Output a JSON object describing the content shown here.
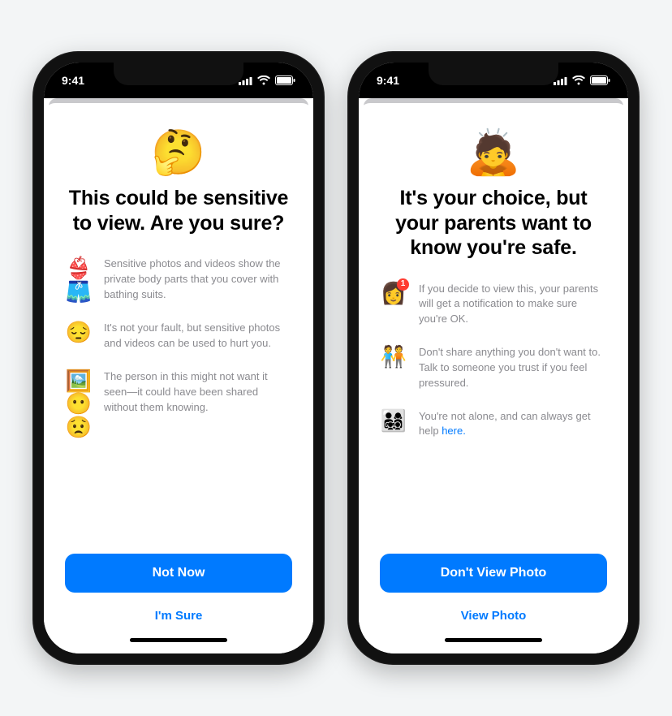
{
  "status": {
    "time": "9:41"
  },
  "left": {
    "emoji": "🤔",
    "title": "This could be sensitive to view. Are you sure?",
    "bullets": [
      {
        "icon": "👙🩳",
        "text": "Sensitive photos and videos show the private body parts that you cover with bathing suits."
      },
      {
        "icon": "😔",
        "text": "It's not your fault, but sensitive photos and videos can be used to hurt you."
      },
      {
        "icon": "🖼️😶😟",
        "text": "The person in this might not want it seen—it could have been shared without them knowing."
      }
    ],
    "primary": "Not Now",
    "secondary": "I'm Sure"
  },
  "right": {
    "emoji": "🙇",
    "title": "It's your choice, but your parents want to know you're safe.",
    "bullets": [
      {
        "icon": "👩",
        "badge": "1",
        "text": "If you decide to view this, your parents will get a notification to make sure you're OK."
      },
      {
        "icon": "🧑‍🤝‍🧑",
        "text": "Don't share anything you don't want to. Talk to someone you trust if you feel pressured."
      },
      {
        "icon": "👨‍👩‍👧‍👦",
        "text": "You're not alone, and can always get help ",
        "link": "here."
      }
    ],
    "primary": "Don't View Photo",
    "secondary": "View Photo"
  }
}
